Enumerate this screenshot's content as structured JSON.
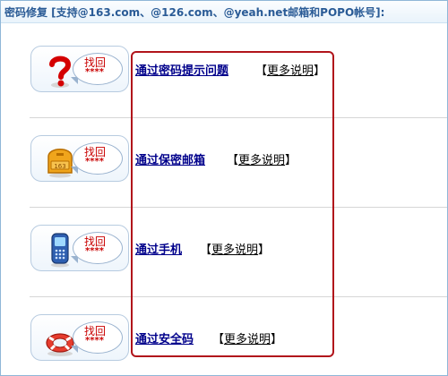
{
  "header": {
    "title": "密码修复 [支持@163.com、@126.com、@yeah.net邮箱和POPO帐号]:"
  },
  "badge": {
    "text": "找回",
    "stars": "****"
  },
  "methods": [
    {
      "label": "通过密码提示问题",
      "icon": "question-mark-icon",
      "more_open": "【",
      "more_link": "更多说明",
      "more_close": "】"
    },
    {
      "label": "通过保密邮箱",
      "icon": "mailbox-icon",
      "more_open": "【",
      "more_link": "更多说明",
      "more_close": "】"
    },
    {
      "label": "通过手机",
      "icon": "mobile-phone-icon",
      "more_open": "【",
      "more_link": "更多说明",
      "more_close": "】"
    },
    {
      "label": "通过安全码",
      "icon": "lifebuoy-icon",
      "more_open": "【",
      "more_link": "更多说明",
      "more_close": "】"
    }
  ],
  "colors": {
    "title": "#2a5b96",
    "link": "#00008b",
    "badge_text": "#c90000",
    "highlight_frame": "#b1141b",
    "question_mark": "#d40000",
    "mailbox": "#f0a51c",
    "lifebuoy": "#e63c2e"
  }
}
